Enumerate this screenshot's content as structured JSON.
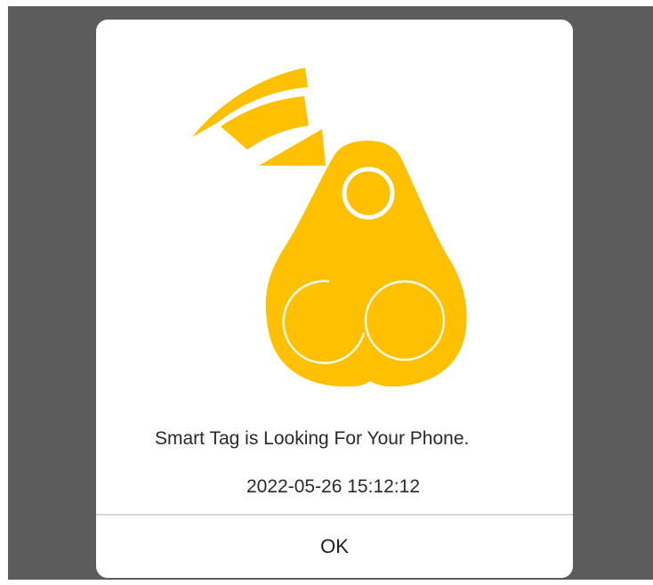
{
  "dialog": {
    "message": "Smart Tag is Looking For Your Phone.",
    "timestamp": "2022-05-26 15:12:12",
    "ok_label": "OK"
  },
  "illustration": {
    "icon": "smart-tag-icon",
    "signal_icon": "wireless-signal-icon"
  },
  "colors": {
    "backdrop": "#5b5c5b",
    "dialog_background": "#ffffff",
    "accent": "#fec000",
    "text": "#2a2a2a",
    "divider": "#d7d7d7"
  }
}
